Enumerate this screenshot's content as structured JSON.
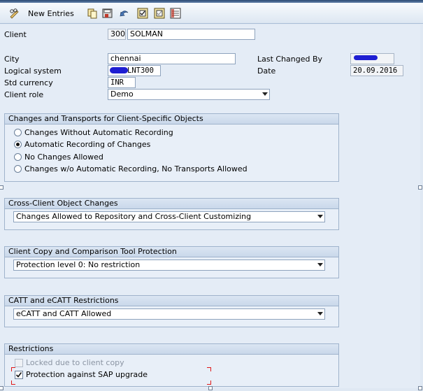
{
  "toolbar": {
    "new_entries_label": "New Entries",
    "icons": [
      "pencil-glasses-icon",
      "copy-icon",
      "save-icon",
      "undo-icon",
      "select-all-icon",
      "deselect-icon",
      "select-block-icon"
    ]
  },
  "form": {
    "client_label": "Client",
    "client_number": "300",
    "client_name": "SOLMAN",
    "city_label": "City",
    "city_value": "chennai",
    "logical_system_label": "Logical system",
    "logical_system_value": "LNT300",
    "std_currency_label": "Std currency",
    "std_currency_value": "INR",
    "client_role_label": "Client role",
    "client_role_value": "Demo",
    "last_changed_by_label": "Last Changed By",
    "last_changed_by_value": "",
    "date_label": "Date",
    "date_value": "20.09.2016"
  },
  "changes_transports": {
    "title": "Changes and Transports for Client-Specific Objects",
    "options": [
      {
        "label": "Changes Without Automatic Recording",
        "selected": false
      },
      {
        "label": "Automatic Recording of Changes",
        "selected": true
      },
      {
        "label": "No Changes Allowed",
        "selected": false
      },
      {
        "label": "Changes w/o Automatic Recording, No Transports Allowed",
        "selected": false
      }
    ]
  },
  "cross_client": {
    "title": "Cross-Client Object Changes",
    "value": "Changes Allowed to Repository and Cross-Client Customizing"
  },
  "copy_protection": {
    "title": "Client Copy and Comparison Tool Protection",
    "value": "Protection level 0: No restriction"
  },
  "catt": {
    "title": "CATT and eCATT Restrictions",
    "value": "eCATT and CATT Allowed"
  },
  "restrictions": {
    "title": "Restrictions",
    "locked_label": "Locked due to client copy",
    "locked_checked": false,
    "protection_label": "Protection against SAP upgrade",
    "protection_checked": true
  },
  "colors": {
    "background": "#e4ecf6",
    "group_header": "#c9d8ea",
    "redaction": "#1e1ed2",
    "highlight_red": "#e01818"
  }
}
